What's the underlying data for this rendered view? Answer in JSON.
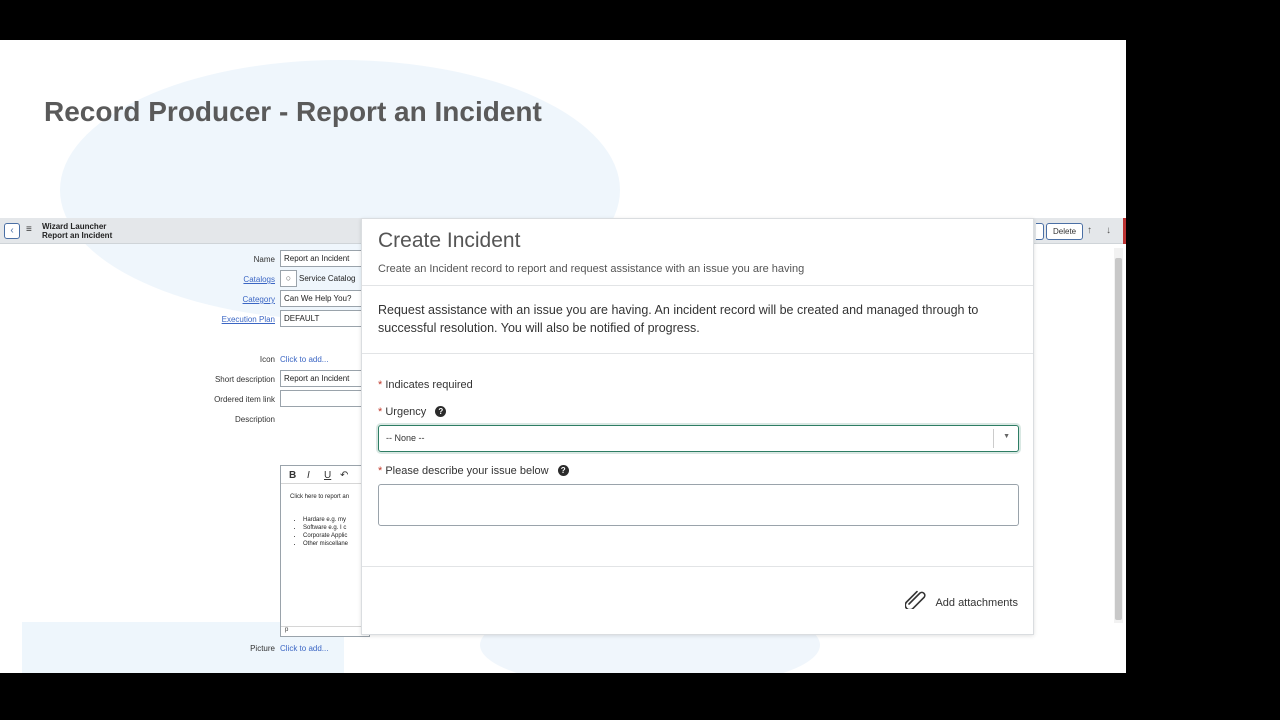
{
  "slide": {
    "title": "Record Producer - Report an Incident"
  },
  "form": {
    "breadcrumb_line1": "Wizard Launcher",
    "breadcrumb_line2": "Report an Incident",
    "back_icon": "chevron-left-icon",
    "menu_icon": "hamburger-icon",
    "delete_label": "Delete",
    "name_label": "Name",
    "name_value": "Report an Incident",
    "catalogs_label": "Catalogs",
    "catalogs_value": "Service Catalog",
    "category_label": "Category",
    "category_value": "Can We Help You?",
    "execution_plan_label": "Execution Plan",
    "execution_plan_value": "DEFAULT",
    "icon_label": "Icon",
    "icon_link": "Click to add...",
    "short_description_label": "Short description",
    "short_description_value": "Report an Incident",
    "ordered_item_link_label": "Ordered item link",
    "description_label": "Description",
    "editor": {
      "bold": "B",
      "italic": "I",
      "underline": "U",
      "undo_icon": "undo-icon",
      "intro_text": "Click here to report an",
      "bullets": [
        "Hardare e.g. my",
        "Software e.g. I c",
        "Corporate Applic",
        "Other miscellane"
      ],
      "footer": "p"
    },
    "picture_label": "Picture",
    "picture_link": "Click to add..."
  },
  "modal": {
    "title": "Create Incident",
    "subtitle": "Create an Incident record to report and request assistance with an issue you are having",
    "description": "Request assistance with an issue you are having. An incident record will be created and managed through to successful resolution. You will also be notified of progress.",
    "required_marker": "*",
    "required_note": "Indicates required",
    "urgency_label": "Urgency",
    "urgency_value": "-- None --",
    "issue_label": "Please describe your issue below",
    "help_icon": "question-circle-icon",
    "attach_icon": "paperclip-icon",
    "attach_label": "Add attachments"
  }
}
